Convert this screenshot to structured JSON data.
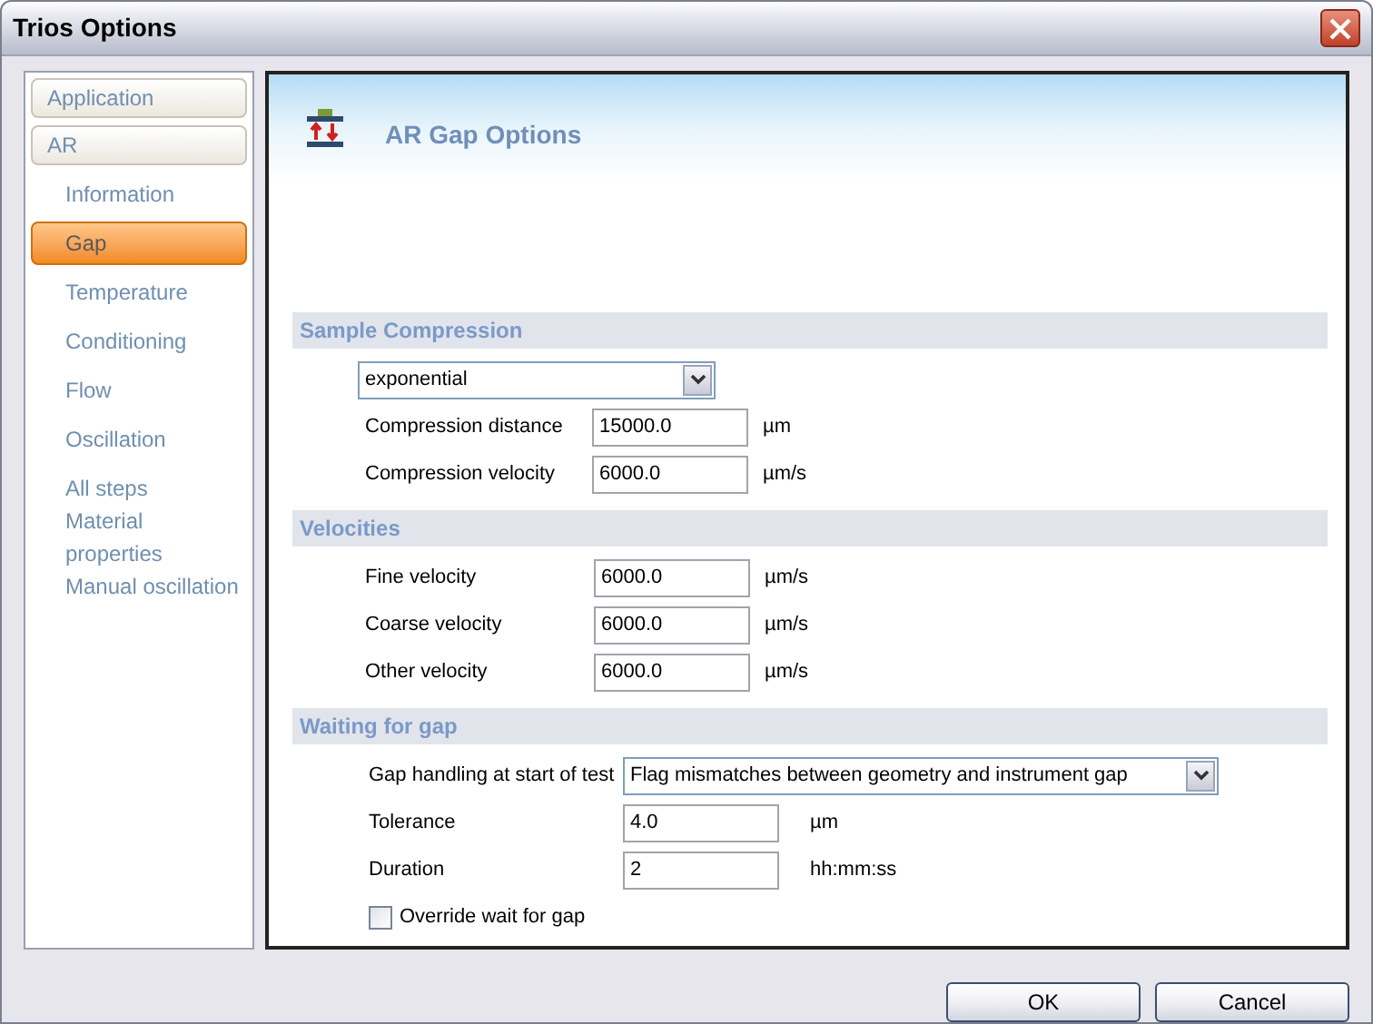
{
  "window": {
    "title": "Trios Options"
  },
  "sidebar": {
    "items": [
      {
        "label": "Application",
        "kind": "group",
        "selected": false
      },
      {
        "label": "AR",
        "kind": "group",
        "selected": false
      },
      {
        "label": "Information",
        "kind": "page",
        "selected": false
      },
      {
        "label": "Gap",
        "kind": "page",
        "selected": true
      },
      {
        "label": "Temperature",
        "kind": "page",
        "selected": false
      },
      {
        "label": "Conditioning",
        "kind": "page",
        "selected": false
      },
      {
        "label": "Flow",
        "kind": "page",
        "selected": false
      },
      {
        "label": "Oscillation",
        "kind": "page",
        "selected": false
      },
      {
        "label": "All steps",
        "kind": "page",
        "selected": false
      },
      {
        "label": "Material properties",
        "kind": "page",
        "selected": false
      },
      {
        "label": "Manual oscillation",
        "kind": "page",
        "selected": false
      }
    ]
  },
  "page": {
    "title": "AR Gap Options"
  },
  "sections": [
    {
      "title": "Sample Compression",
      "rows": [
        {
          "kind": "dropdown",
          "value": "exponential"
        },
        {
          "kind": "field",
          "label": "Compression distance",
          "value": "15000.0",
          "unit": "µm"
        },
        {
          "kind": "field",
          "label": "Compression velocity",
          "value": "6000.0",
          "unit": "µm/s"
        }
      ]
    },
    {
      "title": "Velocities",
      "rows": [
        {
          "kind": "field",
          "label": "Fine velocity",
          "value": "6000.0",
          "unit": "µm/s"
        },
        {
          "kind": "field",
          "label": "Coarse velocity",
          "value": "6000.0",
          "unit": "µm/s"
        },
        {
          "kind": "field",
          "label": "Other velocity",
          "value": "6000.0",
          "unit": "µm/s"
        }
      ]
    },
    {
      "title": "Waiting for gap",
      "rows": [
        {
          "kind": "select",
          "label": "Gap handling at start of test",
          "value": "Flag mismatches between geometry and instrument gap"
        },
        {
          "kind": "field",
          "label": "Tolerance",
          "value": "4.0",
          "unit": "µm"
        },
        {
          "kind": "field",
          "label": "Duration",
          "value": "2",
          "unit": "hh:mm:ss"
        },
        {
          "kind": "checkbox",
          "label": "Override wait for gap",
          "checked": false
        }
      ]
    }
  ],
  "buttons": [
    "OK",
    "Cancel"
  ]
}
